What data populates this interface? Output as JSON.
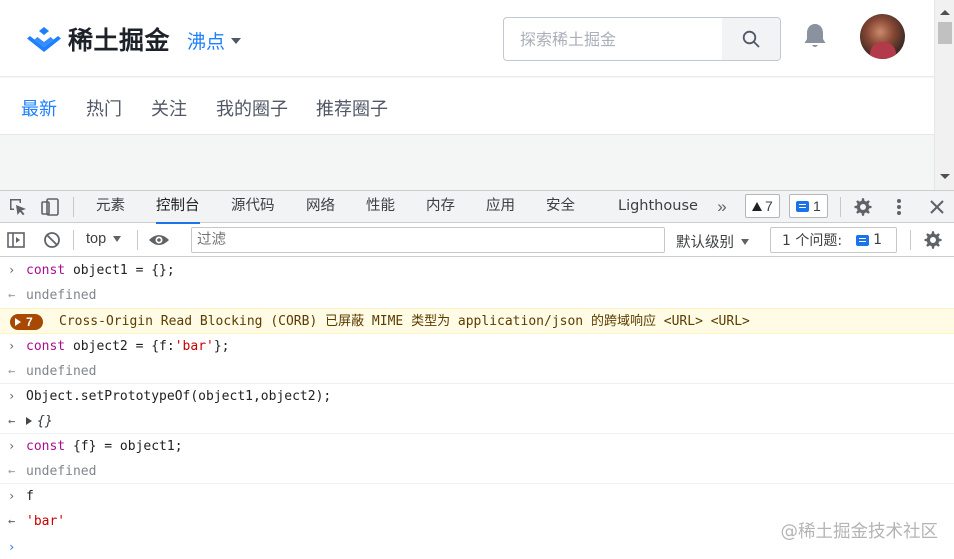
{
  "site": {
    "logo_text": "稀土掘金",
    "nav_label": "沸点",
    "search_placeholder": "探索稀土掘金",
    "brand_color": "#1e80ff"
  },
  "tabs": [
    {
      "label": "最新",
      "active": true
    },
    {
      "label": "热门",
      "active": false
    },
    {
      "label": "关注",
      "active": false
    },
    {
      "label": "我的圈子",
      "active": false
    },
    {
      "label": "推荐圈子",
      "active": false
    }
  ],
  "devtools": {
    "tabs": [
      "元素",
      "控制台",
      "源代码",
      "网络",
      "性能",
      "内存",
      "应用",
      "安全",
      "Lighthouse"
    ],
    "active_tab": "控制台",
    "warnings_count": "7",
    "messages_count": "1",
    "context": "top",
    "filter_placeholder": "过滤",
    "level": "默认级别",
    "issues_label": "1 个问题:",
    "issues_count": "1"
  },
  "console": {
    "lines": [
      {
        "kind": "input",
        "parts": [
          [
            "kw",
            "const"
          ],
          [
            "",
            " object1 = {};"
          ]
        ]
      },
      {
        "kind": "result",
        "text": "undefined"
      },
      {
        "kind": "warning",
        "count": "7",
        "text": "Cross-Origin Read Blocking (CORB) 已屏蔽 MIME 类型为 application/json 的跨域响应 <URL> <URL>"
      },
      {
        "kind": "input",
        "parts": [
          [
            "kw",
            "const"
          ],
          [
            "",
            " object2 = {f:"
          ],
          [
            "str",
            "'bar'"
          ],
          [
            "",
            "};"
          ]
        ]
      },
      {
        "kind": "result",
        "text": "undefined"
      },
      {
        "kind": "input",
        "parts": [
          [
            "",
            "Object.setPrototypeOf(object1,object2);"
          ]
        ]
      },
      {
        "kind": "object",
        "text": "{}"
      },
      {
        "kind": "input",
        "parts": [
          [
            "kw",
            "const"
          ],
          [
            "",
            " {f} = object1;"
          ]
        ]
      },
      {
        "kind": "result",
        "text": "undefined"
      },
      {
        "kind": "input",
        "parts": [
          [
            "",
            "f"
          ]
        ]
      },
      {
        "kind": "string",
        "text": "'bar'"
      }
    ]
  },
  "watermark": "@稀土掘金技术社区"
}
